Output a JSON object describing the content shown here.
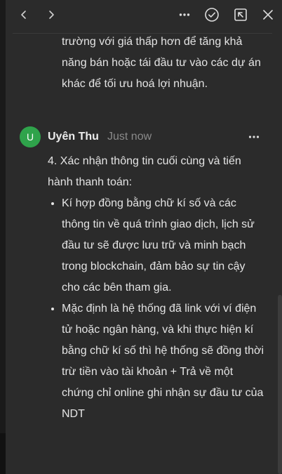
{
  "toolbar": {
    "back_icon": "chevron-left-icon",
    "forward_icon": "chevron-right-icon",
    "more_icon": "more-horizontal-icon",
    "resolve_icon": "check-circle-icon",
    "open_icon": "open-external-icon",
    "close_icon": "close-icon"
  },
  "previous_comment": {
    "text_tail": "trường với giá thấp hơn để tăng khả năng bán hoặc tái đầu tư vào các dự án khác để tối ưu hoá lợi nhuận."
  },
  "comment": {
    "avatar_letter": "U",
    "avatar_color": "#2fa34b",
    "author": "Uyên Thu",
    "timestamp": "Just now",
    "heading": "4. Xác nhận thông tin cuối cùng và tiến hành thanh toán:",
    "bullets": [
      "Kí hợp đồng bằng chữ kí số và các thông tin về quá trình giao dịch, lịch sử đầu tư sẽ được lưu trữ và minh bạch trong blockchain, đảm bảo sự tin cậy cho các bên tham gia.",
      "Mặc định là hệ thống đã link với ví điện tử hoặc ngân hàng, và khi thực hiện kí bằng chữ kí số thì hệ thống sẽ đồng thời trừ tiền vào tài khoản +  Trả về một chứng chỉ online ghi nhận sự đầu tư của NDT"
    ]
  },
  "colors": {
    "panel_bg": "#2b2b2b",
    "text": "#e4e4e4",
    "muted": "#8a8a8a",
    "accent_green": "#2fa34b"
  }
}
